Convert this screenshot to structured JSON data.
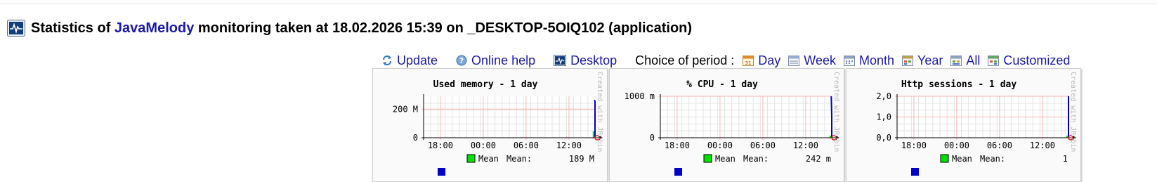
{
  "header": {
    "title_prefix": "Statistics of ",
    "title_brand": "JavaMelody",
    "title_suffix": " monitoring taken at 18.02.2026 15:39 on _DESKTOP-5OIQ102 (application)"
  },
  "toolbar": {
    "update": "Update",
    "online_help": "Online help",
    "desktop": "Desktop",
    "period_label": "Choice of period :",
    "periods": [
      "Day",
      "Week",
      "Month",
      "Year",
      "All",
      "Customized"
    ]
  },
  "colors": {
    "brand": "#1a1aa6",
    "grid": "#ffb4b4",
    "mean_series": "#00e000",
    "max_series": "#0000c8"
  },
  "chart_data": [
    {
      "type": "area",
      "title": "Used memory - 1 day",
      "watermark": "Created with JRobin",
      "x_ticks": [
        "18:00",
        "00:00",
        "06:00",
        "12:00"
      ],
      "y_ticks": [
        "0",
        "200 M"
      ],
      "ylim": [
        0,
        290
      ],
      "grid": true,
      "legend": {
        "series": "Mean",
        "stat_label": "Mean:",
        "stat_value": "189 M"
      },
      "series": [
        {
          "name": "Mean",
          "x": [
            "15:20",
            "15:39"
          ],
          "values": [
            45,
            45
          ]
        },
        {
          "x": [
            "15:30",
            "15:39"
          ],
          "values": [
            260,
            260
          ]
        }
      ]
    },
    {
      "type": "area",
      "title": "% CPU - 1 day",
      "watermark": "Created with JRobin",
      "x_ticks": [
        "18:00",
        "00:00",
        "06:00",
        "12:00"
      ],
      "y_ticks": [
        "0",
        "1000 m"
      ],
      "ylim": [
        0,
        1000
      ],
      "grid": true,
      "legend": {
        "series": "Mean",
        "stat_label": "Mean:",
        "stat_value": "242 m"
      },
      "series": [
        {
          "name": "Mean",
          "x": [
            "15:35",
            "15:39"
          ],
          "values": [
            0,
            0
          ]
        },
        {
          "x": [
            "15:35",
            "15:39"
          ],
          "values": [
            1000,
            500
          ]
        }
      ]
    },
    {
      "type": "area",
      "title": "Http sessions - 1 day",
      "watermark": "Created with JRobin",
      "x_ticks": [
        "18:00",
        "00:00",
        "06:00",
        "12:00"
      ],
      "y_ticks": [
        "0,0",
        "1,0",
        "2,0"
      ],
      "ylim": [
        0,
        2
      ],
      "grid": true,
      "legend": {
        "series": "Mean",
        "stat_label": "Mean:",
        "stat_value": "1"
      },
      "series": [
        {
          "name": "Mean",
          "x": [
            "15:36",
            "15:39"
          ],
          "values": [
            0,
            0
          ]
        },
        {
          "x": [
            "15:36",
            "15:39"
          ],
          "values": [
            2,
            2
          ]
        }
      ]
    }
  ]
}
